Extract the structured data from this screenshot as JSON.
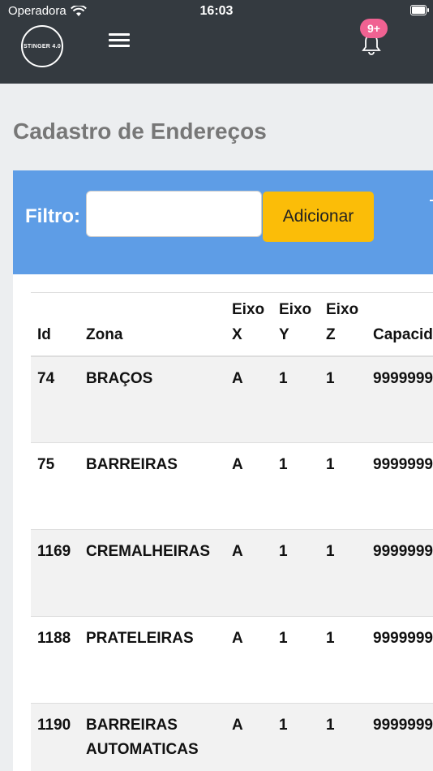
{
  "status_bar": {
    "carrier": "Operadora",
    "time": "16:03"
  },
  "header": {
    "logo_text": "STINGER 4.0",
    "notification_count": "9+"
  },
  "page": {
    "title": "Cadastro de Endereços"
  },
  "filter": {
    "label": "Filtro:",
    "value": "",
    "placeholder": "",
    "add_button": "Adicionar"
  },
  "table": {
    "headers": {
      "id": "Id",
      "zona": "Zona",
      "eixo_x": "Eixo X",
      "eixo_y": "Eixo Y",
      "eixo_z": "Eixo Z",
      "capacidade": "Capacid"
    },
    "rows": [
      {
        "id": "74",
        "zona": "BRAÇOS",
        "x": "A",
        "y": "1",
        "z": "1",
        "capacidade": "9999999"
      },
      {
        "id": "75",
        "zona": "BARREIRAS",
        "x": "A",
        "y": "1",
        "z": "1",
        "capacidade": "9999999"
      },
      {
        "id": "1169",
        "zona": "CREMALHEIRAS",
        "x": "A",
        "y": "1",
        "z": "1",
        "capacidade": "9999999"
      },
      {
        "id": "1188",
        "zona": "PRATELEIRAS",
        "x": "A",
        "y": "1",
        "z": "1",
        "capacidade": "9999999"
      },
      {
        "id": "1190",
        "zona": "BARREIRAS AUTOMATICAS",
        "x": "A",
        "y": "1",
        "z": "1",
        "capacidade": "9999999"
      }
    ]
  },
  "colors": {
    "topbar": "#343a40",
    "filter_bar": "#5e9de6",
    "add_button": "#fbbd08",
    "badge": "#f06292"
  }
}
